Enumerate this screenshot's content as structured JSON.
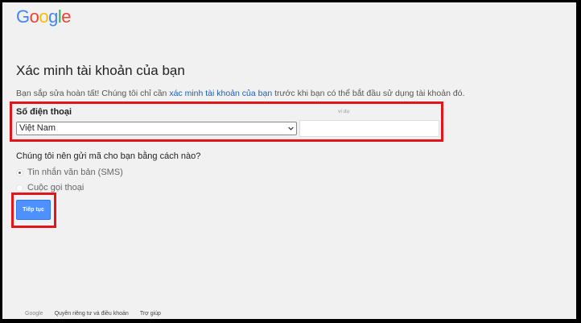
{
  "logo": {
    "letters": [
      "G",
      "o",
      "o",
      "g",
      "l",
      "e"
    ],
    "colors": [
      "#4285f4",
      "#ea4335",
      "#fbbc05",
      "#4285f4",
      "#34a853",
      "#ea4335"
    ]
  },
  "page": {
    "title": "Xác minh tài khoản của bạn",
    "intro_before": "Bạn sắp sửa hoàn tất! Chúng tôi chỉ cần ",
    "intro_link": "xác minh tài khoản của bạn",
    "intro_after": " trước khi bạn có thể bắt đầu sử dụng tài khoản đó."
  },
  "phone": {
    "label": "Số điện thoại",
    "example_label": "ví dụ",
    "country_selected": "Việt Nam",
    "number_value": ""
  },
  "method": {
    "question": "Chúng tôi nên gửi mã cho bạn bằng cách nào?",
    "options": [
      {
        "label": "Tin nhắn văn bản (SMS)",
        "checked": true
      },
      {
        "label": "Cuộc gọi thoại",
        "checked": false
      }
    ]
  },
  "actions": {
    "continue_label": "Tiếp tục"
  },
  "footer": {
    "brand": "Google",
    "privacy_terms": "Quyền riêng tư và điều khoản",
    "help": "Trợ giúp"
  },
  "colors": {
    "highlight": "#e0161c",
    "button": "#4d90fe",
    "link": "#1a5fc2"
  }
}
